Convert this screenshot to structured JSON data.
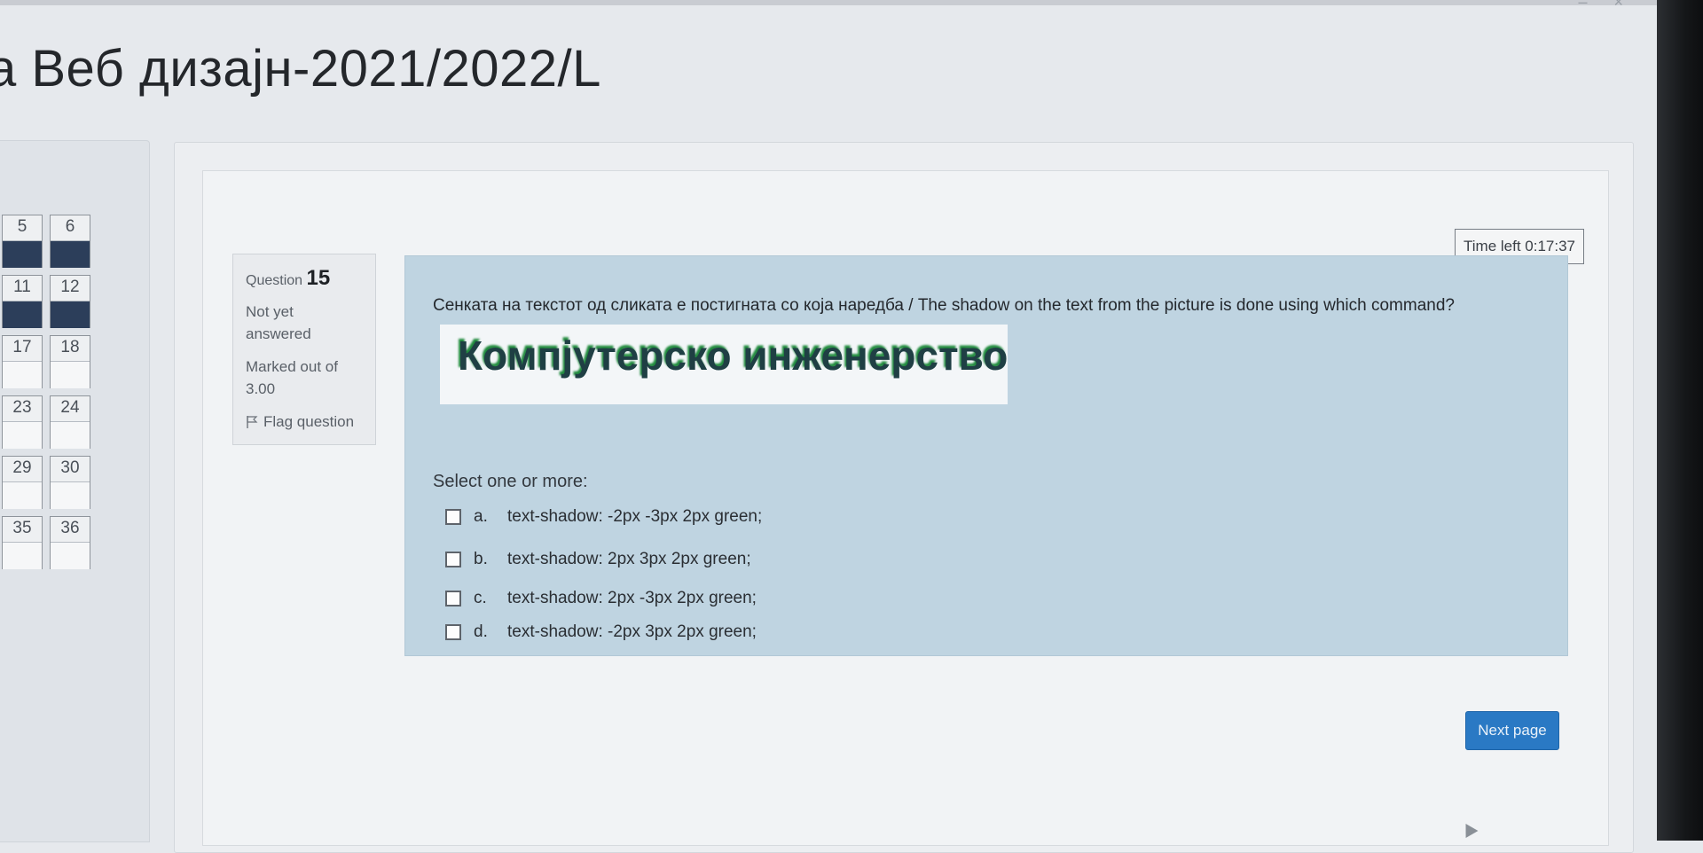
{
  "page": {
    "title": "а Веб дизајн-2021/2022/L"
  },
  "quiz_nav": {
    "buttons": [
      {
        "label": "5",
        "answered": true
      },
      {
        "label": "6",
        "answered": true
      },
      {
        "label": "11",
        "answered": true
      },
      {
        "label": "12",
        "answered": true
      },
      {
        "label": "17",
        "answered": false
      },
      {
        "label": "18",
        "answered": false
      },
      {
        "label": "23",
        "answered": false
      },
      {
        "label": "24",
        "answered": false
      },
      {
        "label": "29",
        "answered": false
      },
      {
        "label": "30",
        "answered": false
      },
      {
        "label": "35",
        "answered": false
      },
      {
        "label": "36",
        "answered": false
      }
    ]
  },
  "timer": {
    "text": "Time left 0:17:37"
  },
  "question_info": {
    "prefix": "Question",
    "number": "15",
    "status_line1": "Not yet",
    "status_line2": "answered",
    "marks_line1": "Marked out of",
    "marks_line2": "3.00",
    "flag_label": "Flag question"
  },
  "question": {
    "text": "Сенката на текстот од сликата е постигната со која наредба / The shadow on the text from the picture is done using which command?",
    "image_text": "Компјутерско инженерство",
    "prompt": "Select one or more:",
    "options": [
      {
        "letter": "a.",
        "text": "text-shadow: -2px -3px 2px green;"
      },
      {
        "letter": "b.",
        "text": "text-shadow: 2px 3px 2px green;"
      },
      {
        "letter": "c.",
        "text": "text-shadow: 2px -3px 2px green;"
      },
      {
        "letter": "d.",
        "text": "text-shadow: -2px 3px 2px green;"
      }
    ]
  },
  "actions": {
    "next_label": "Next page"
  },
  "colors": {
    "accent": "#2a79c4",
    "question_bg": "#bfd4e1",
    "answered_fill": "#2c3e5a",
    "shadow_green": "#1f8a3c"
  }
}
